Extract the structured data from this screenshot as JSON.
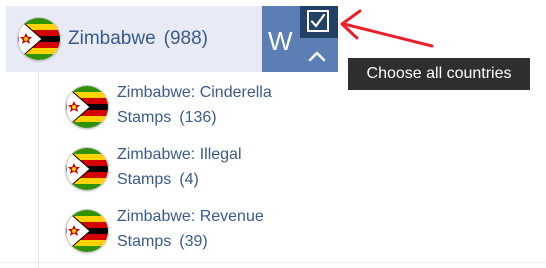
{
  "country": {
    "name": "Zimbabwe",
    "count": "(988)",
    "flag_icon": "zimbabwe-flag-icon"
  },
  "letter_block": {
    "letter": "W",
    "checkbox_checked": true,
    "checkbox_icon": "checkmark-icon",
    "collapse_icon": "chevron-up-icon"
  },
  "tooltip": {
    "text": "Choose all countries"
  },
  "annotation": {
    "arrow_color": "#e8202a"
  },
  "subcategories": [
    {
      "line1": "Zimbabwe: Cinderella",
      "line2": "Stamps",
      "count": "(136)"
    },
    {
      "line1": "Zimbabwe: Illegal",
      "line2": "Stamps",
      "count": "(4)"
    },
    {
      "line1": "Zimbabwe: Revenue",
      "line2": "Stamps",
      "count": "(39)"
    }
  ],
  "colors": {
    "row_background": "#e8eaf6",
    "link_text": "#3a5a8c",
    "letter_block": "#5b7fb4",
    "checkbox_background": "#234067",
    "tooltip_background": "#2f2f2f"
  }
}
